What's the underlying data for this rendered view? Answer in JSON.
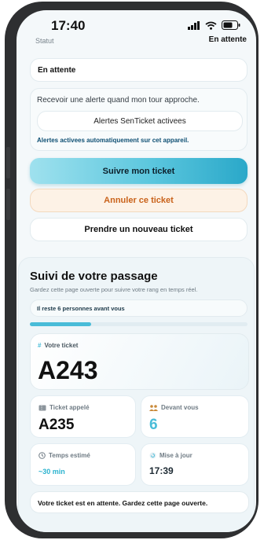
{
  "status_bar": {
    "time": "17:40"
  },
  "status_row": {
    "label": "Statut",
    "value": "En attente"
  },
  "status_box": {
    "text": "En attente"
  },
  "alert_section": {
    "prompt": "Recevoir une alerte quand mon tour approche.",
    "button_label": "Alertes SenTicket activees",
    "confirmation": "Alertes activees automatiquement sur cet appareil."
  },
  "actions": {
    "follow": "Suivre mon ticket",
    "cancel": "Annuler ce ticket",
    "new": "Prendre un nouveau ticket"
  },
  "tracking": {
    "title": "Suivi de votre passage",
    "subtitle": "Gardez cette page ouverte pour suivre votre rang en temps réel.",
    "remaining": "Il reste 6 personnes avant vous",
    "progress": 0.28,
    "ticket_label": "Votre ticket",
    "ticket_number": "A243",
    "called_label": "Ticket appelé",
    "called_value": "A235",
    "ahead_label": "Devant vous",
    "ahead_value": "6",
    "estimate_label": "Temps estimé",
    "estimate_value": "~30 min",
    "updated_label": "Mise à jour",
    "updated_value": "17:39",
    "footer": "Votre ticket est en attente. Gardez cette page ouverte."
  },
  "colors": {
    "accent": "#2bb3cf",
    "cancel_text": "#c9621a",
    "progress_fill": "#49bcd8"
  }
}
